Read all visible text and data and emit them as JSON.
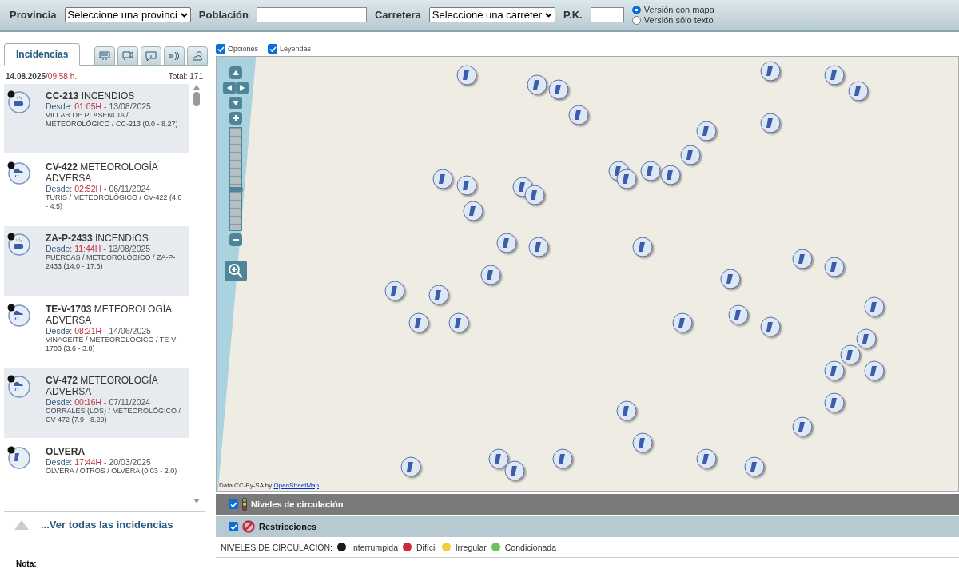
{
  "search_bar": {
    "fields": [
      {
        "kind": "select",
        "label": "Provincia",
        "value": "Seleccione una provinci"
      },
      {
        "kind": "text",
        "label": "Población"
      },
      {
        "kind": "select",
        "label": "Carretera",
        "value": "Seleccione una carreter"
      },
      {
        "kind": "text",
        "label": "P.K."
      }
    ],
    "view_options": [
      {
        "label": "Versión con mapa",
        "selected": true
      },
      {
        "label": "Versión sólo texto",
        "selected": false
      }
    ]
  },
  "sidebar": {
    "tabs": [
      {
        "kind": "text",
        "label": "Incidencias",
        "selected": true
      },
      {
        "kind": "icon",
        "selected": false
      },
      {
        "kind": "icon",
        "selected": false
      },
      {
        "kind": "icon",
        "selected": false
      },
      {
        "kind": "icon",
        "selected": false
      },
      {
        "kind": "icon",
        "selected": false
      }
    ],
    "date": "14.08.2025",
    "time": "/09:58 h.",
    "total": "Total: 171",
    "incidents": [
      {
        "kind": "fire",
        "color": "#111111",
        "road": "CC-213",
        "type": "INCENDIOS",
        "since": "Desde:",
        "time": "01:05H",
        "date": "- 13/08/2025",
        "detail": "VILLAR DE PLASENCIA / METEOROLÓGICO / CC-213 (0.0 - 8.27)"
      },
      {
        "kind": "weather",
        "color": "#111111",
        "road": "CV-422",
        "type": "METEOROLOGÍA ADVERSA",
        "since": "Desde:",
        "time": "02:52H",
        "date": "- 06/11/2024",
        "detail": "TURIS / METEOROLÓGICO / CV-422 (4.0 - 4.5)"
      },
      {
        "kind": "fire",
        "color": "#111111",
        "road": "ZA-P-2433",
        "type": "INCENDIOS",
        "since": "Desde:",
        "time": "11:44H",
        "date": "- 13/08/2025",
        "detail": "PUERCAS / METEOROLÓGICO / ZA-P-2433 (14.0 - 17.6)"
      },
      {
        "kind": "weather",
        "color": "#111111",
        "road": "TE-V-1703",
        "type": "METEOROLOGÍA ADVERSA",
        "since": "Desde:",
        "time": "08:21H",
        "date": "- 14/06/2025",
        "detail": "VINACEITE / METEOROLÓGICO / TE-V-1703 (3.6 - 3.8)"
      },
      {
        "kind": "weather",
        "color": "#111111",
        "road": "CV-472",
        "type": "METEOROLOGÍA ADVERSA",
        "since": "Desde:",
        "time": "00:16H",
        "date": "- 07/11/2024",
        "detail": "CORRALES (LOS) / METEOROLÓGICO / CV-472 (7.9 - 8.29)"
      },
      {
        "kind": "other",
        "color": "#111111",
        "road": "OLVERA",
        "since": "Desde:",
        "time": "17:44H",
        "date": "- 20/03/2025",
        "detail": "OLVERA / OTROS / OLVERA (0.03 - 2.0)"
      }
    ],
    "more_link": "...Ver todas las incidencias"
  },
  "map": {
    "options": [
      {
        "label": "Opciones",
        "checked": true
      },
      {
        "label": "Leyendas",
        "checked": true
      }
    ],
    "zoom": {
      "level": 0.4
    },
    "attribution": {
      "text": "Data CC-By-SA by",
      "link": "OpenStreetMap"
    }
  },
  "layers": [
    {
      "kind": "traffic",
      "label": "Niveles de circulación",
      "checked": true,
      "selected": true
    },
    {
      "kind": "restrictions",
      "label": "Restricciones",
      "checked": true,
      "selected": false
    }
  ],
  "legend": {
    "title": "NIVELES DE CIRCULACIÓN:",
    "items": [
      {
        "label": "Interrumpida",
        "color": "#1a1a1a"
      },
      {
        "label": "Difícil",
        "color": "#d0283a"
      },
      {
        "label": "Irregular",
        "color": "#e8d33a"
      },
      {
        "label": "Condicionada",
        "color": "#6cc35a"
      }
    ]
  },
  "note": "Nota:"
}
